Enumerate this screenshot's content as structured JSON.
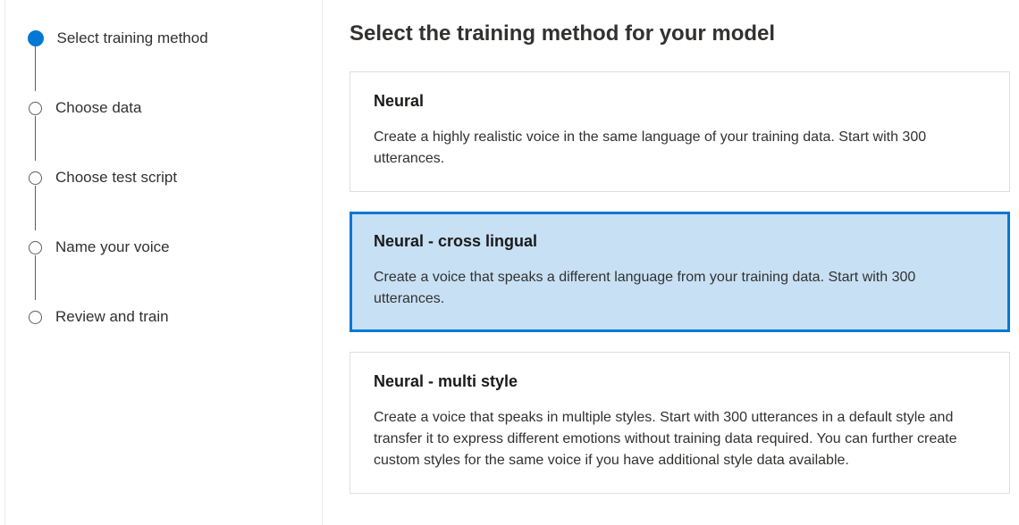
{
  "sidebar": {
    "steps": [
      {
        "label": "Select training method",
        "active": true
      },
      {
        "label": "Choose data",
        "active": false
      },
      {
        "label": "Choose test script",
        "active": false
      },
      {
        "label": "Name your voice",
        "active": false
      },
      {
        "label": "Review and train",
        "active": false
      }
    ]
  },
  "main": {
    "title": "Select the training method for your model",
    "options": [
      {
        "title": "Neural",
        "description": "Create a highly realistic voice in the same language of your training data. Start with 300 utterances.",
        "selected": false
      },
      {
        "title": "Neural - cross lingual",
        "description": "Create a voice that speaks a different language from your training data. Start with 300 utterances.",
        "selected": true
      },
      {
        "title": "Neural - multi style",
        "description": "Create a voice that speaks in multiple styles. Start with 300 utterances in a default style and transfer it to express different emotions without training data required. You can further create custom styles for the same voice if you have additional style data available.",
        "selected": false
      }
    ]
  }
}
